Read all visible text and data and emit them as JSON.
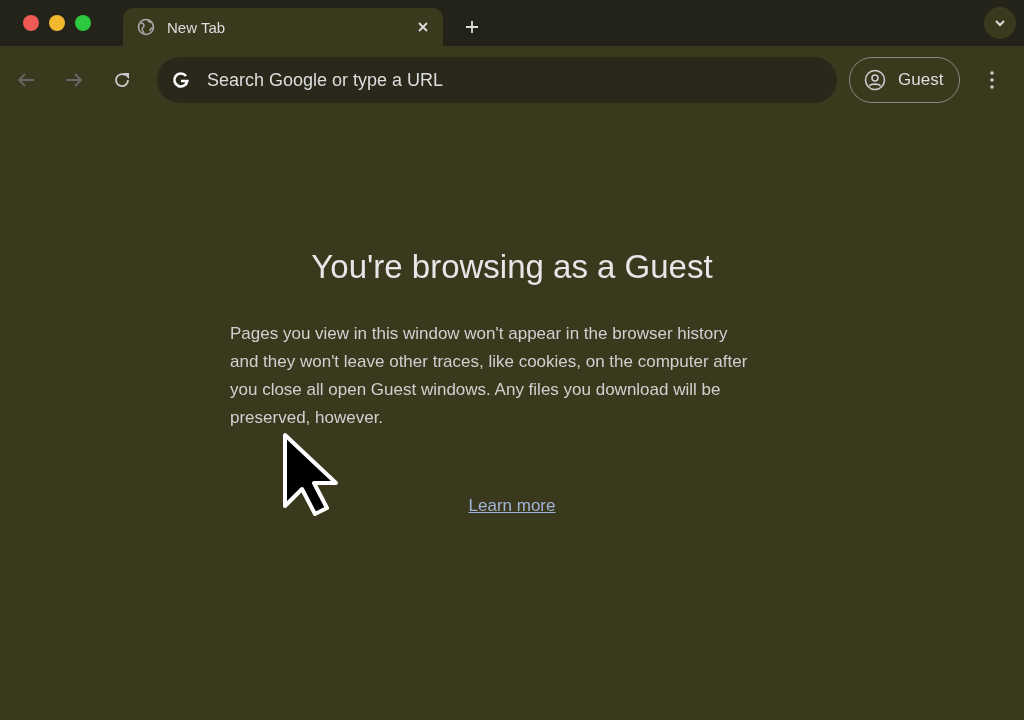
{
  "tabs": [
    {
      "title": "New Tab",
      "selected": true
    }
  ],
  "omnibox": {
    "placeholder": "Search Google or type a URL"
  },
  "profile": {
    "label": "Guest"
  },
  "page": {
    "heading": "You're browsing as a Guest",
    "body": "Pages you view in this window won't appear in the browser history and they won't leave other traces, like cookies, on the computer after you close all open Guest windows. Any files you download will be preserved, however.",
    "link": "Learn more"
  }
}
